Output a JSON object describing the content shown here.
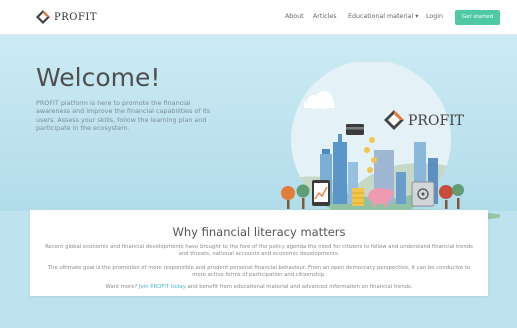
{
  "brand": {
    "name": "PROFIT"
  },
  "nav": {
    "items": [
      "About",
      "Articles",
      "Educational material ▾",
      "Login"
    ],
    "cta": "Get started"
  },
  "hero": {
    "title": "Welcome!",
    "text": "PROFIT platform is here to promote the financial awareness and improve the financial capabilities of its users. Assess your skills, follow the learning plan and participate in the ecosystem.",
    "logo_text": "PROFIT"
  },
  "section": {
    "title": "Why financial literacy matters",
    "p1": "Recent global economic and financial developments have brought to the fore of the policy agenda the need for citizens to follow and understand financial trends and threats, national accounts and economic developments.",
    "p2": "The ultimate goal is the promotion of more responsible and prudent personal financial behaviour. From an open democracy perspective, it can be conducive to more active forms of participation and citizenship.",
    "p3_prefix": "Want more? ",
    "p3_link": "Join PROFIT today",
    "p3_suffix": " and benefit from educational material and advanced information on financial trends."
  },
  "colors": {
    "accent": "#4fc9a3",
    "link": "#4fb6c9",
    "hero_bg": "#bfe3ee"
  }
}
